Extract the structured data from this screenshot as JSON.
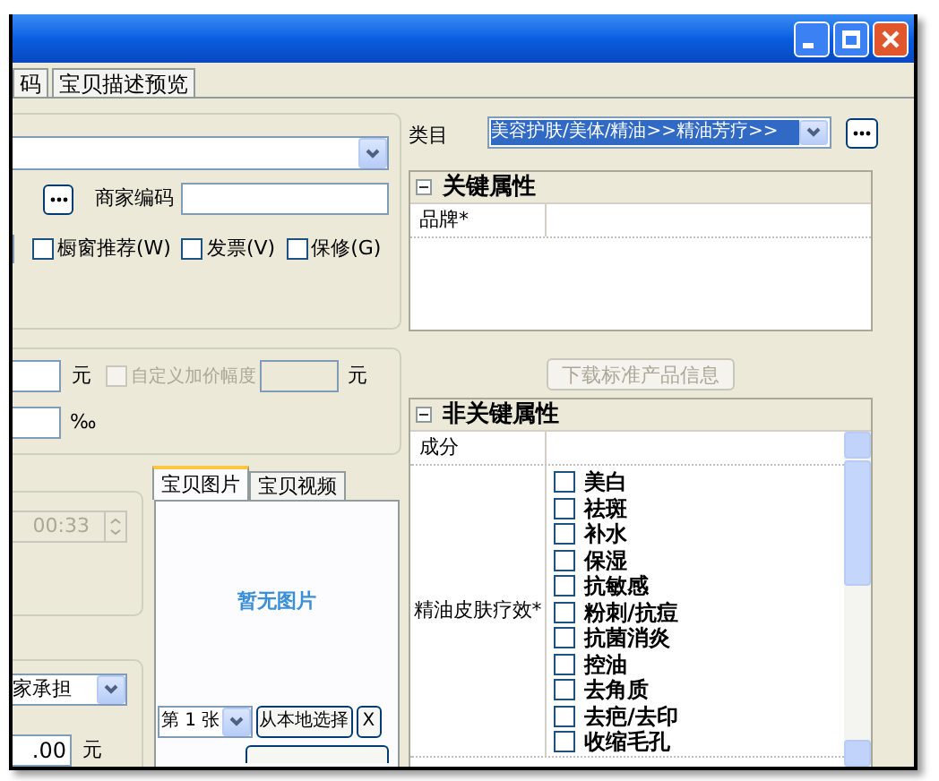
{
  "tabs": [
    {
      "label": "码",
      "selected": false
    },
    {
      "label": "宝贝描述预览",
      "selected": false
    }
  ],
  "basic": {
    "merchant_code_label": "商家编码",
    "options": [
      {
        "label": "橱窗推荐(W)",
        "checked": false
      },
      {
        "label": "发票(V)",
        "checked": false
      },
      {
        "label": "保修(G)",
        "checked": false
      }
    ]
  },
  "pricing": {
    "unit_1": "元",
    "custom_markup": {
      "label": "自定义加价幅度",
      "checked": false,
      "disabled": true
    },
    "unit_2": "元",
    "unit_3": "‰"
  },
  "time_field": {
    "value": "00:33",
    "disabled": true
  },
  "shipping": {
    "value": "家承担",
    "amount": ".00",
    "unit": "元"
  },
  "image_panel": {
    "tabs": [
      {
        "label": "宝贝图片",
        "selected": true
      },
      {
        "label": "宝贝视频",
        "selected": false
      }
    ],
    "empty_text": "暂无图片",
    "page_select": "第 1 张",
    "local_button": "从本地选择",
    "remove_button": "X"
  },
  "category": {
    "label": "类目",
    "value": "美容护肤/美体/精油>>精油芳疗>>"
  },
  "key_properties": {
    "title": "关键属性",
    "expanded": true,
    "rows": [
      {
        "kind": "text",
        "name": "品牌*"
      }
    ]
  },
  "download_button": {
    "label": "下载标准产品信息",
    "disabled": true
  },
  "other_properties": {
    "title": "非关键属性",
    "expanded": true,
    "rows": [
      {
        "kind": "text",
        "name": "成分"
      },
      {
        "kind": "checklist",
        "name": "精油皮肤疗效*",
        "options": [
          {
            "label": "美白",
            "checked": false
          },
          {
            "label": "祛斑",
            "checked": false
          },
          {
            "label": "补水",
            "checked": false
          },
          {
            "label": "保湿",
            "checked": false
          },
          {
            "label": "抗敏感",
            "checked": false
          },
          {
            "label": "粉刺/抗痘",
            "checked": false
          },
          {
            "label": "抗菌消炎",
            "checked": false
          },
          {
            "label": "控油",
            "checked": false
          },
          {
            "label": "去角质",
            "checked": false
          },
          {
            "label": "去疤/去印",
            "checked": false
          },
          {
            "label": "收缩毛孔",
            "checked": false
          }
        ]
      }
    ]
  }
}
